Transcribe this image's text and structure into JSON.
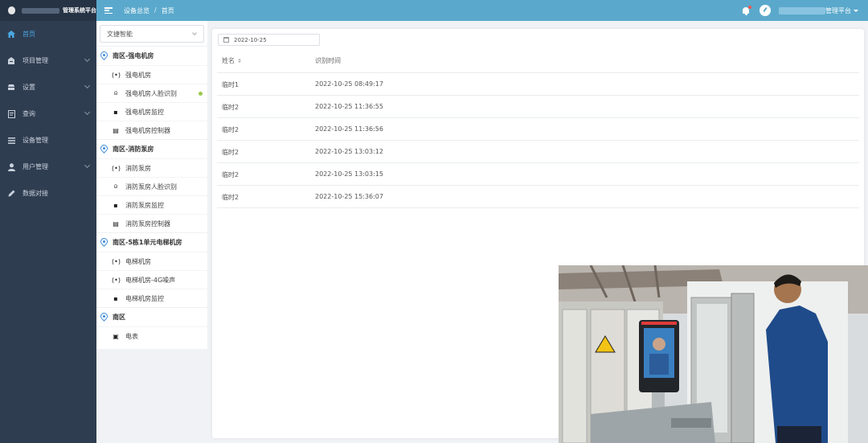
{
  "nav": {
    "brand_title": "管理系统平台",
    "items": [
      {
        "label": "首页",
        "icon": "home-icon",
        "active": true
      },
      {
        "label": "项目管理",
        "icon": "building-icon",
        "has_children": true
      },
      {
        "label": "设置",
        "icon": "settings-icon",
        "has_children": true
      },
      {
        "label": "查询",
        "icon": "search-doc-icon",
        "has_children": true
      },
      {
        "label": "设备管理",
        "icon": "list-icon"
      },
      {
        "label": "用户管理",
        "icon": "user-icon",
        "has_children": true
      },
      {
        "label": "数据对接",
        "icon": "pen-icon"
      }
    ]
  },
  "header": {
    "breadcrumb": [
      "设备总览",
      "首页"
    ],
    "breadcrumb_sep": "/",
    "user_name": "管理平台"
  },
  "tree": {
    "select_value": "文捷智能",
    "groups": [
      {
        "title": "南区-强电机房",
        "items": [
          {
            "label": "强电机房",
            "icon": "radio-icon"
          },
          {
            "label": "强电机房人脸识别",
            "icon": "face-id-icon",
            "online": true
          },
          {
            "label": "强电机房监控",
            "icon": "camera-icon"
          },
          {
            "label": "强电机房控制器",
            "icon": "controller-icon"
          }
        ]
      },
      {
        "title": "南区-消防泵房",
        "items": [
          {
            "label": "消防泵房",
            "icon": "radio-icon"
          },
          {
            "label": "消防泵房人脸识别",
            "icon": "face-id-icon"
          },
          {
            "label": "消防泵房监控",
            "icon": "camera-icon"
          },
          {
            "label": "消防泵房控制器",
            "icon": "controller-icon"
          }
        ]
      },
      {
        "title": "南区-5栋1单元电梯机房",
        "items": [
          {
            "label": "电梯机房",
            "icon": "radio-icon"
          },
          {
            "label": "电梯机房-4G噪声",
            "icon": "radio-icon"
          },
          {
            "label": "电梯机房监控",
            "icon": "camera-icon"
          }
        ]
      },
      {
        "title": "南区",
        "items": [
          {
            "label": "电表",
            "icon": "meter-icon"
          }
        ]
      }
    ]
  },
  "filter": {
    "date": "2022-10-25"
  },
  "table": {
    "columns": [
      "姓名",
      "识别时间"
    ],
    "rows": [
      [
        "临时1",
        "2022-10-25 08:49:17"
      ],
      [
        "临时2",
        "2022-10-25 11:36:55"
      ],
      [
        "临时2",
        "2022-10-25 11:36:56"
      ],
      [
        "临时2",
        "2022-10-25 13:03:12"
      ],
      [
        "临时2",
        "2022-10-25 13:03:15"
      ],
      [
        "临时2",
        "2022-10-25 15:36:07"
      ]
    ]
  },
  "colors": {
    "header_bg": "#5aa9cc",
    "nav_bg": "#2f3d51",
    "nav_active": "#4aa8e0",
    "online_dot": "#9ac84a",
    "notify_dot": "#f5544e"
  }
}
